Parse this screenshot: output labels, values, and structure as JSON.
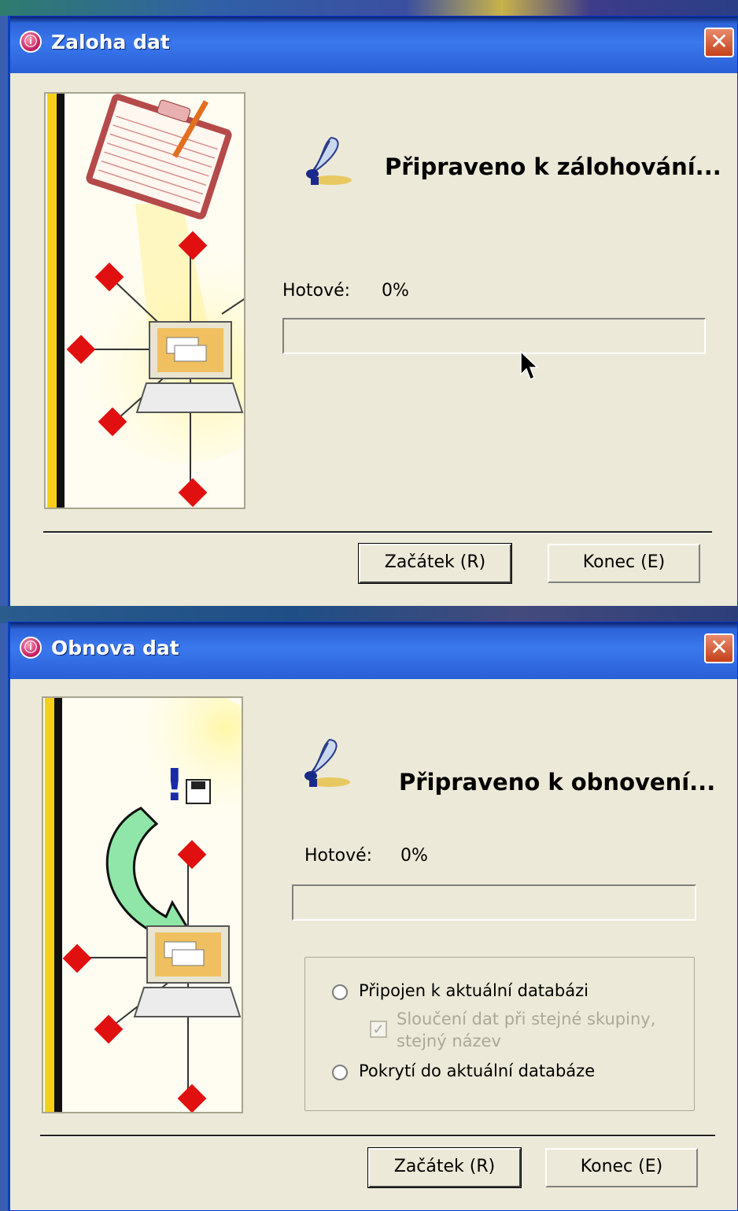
{
  "backup_dialog": {
    "title": "Zaloha dat",
    "close_glyph": "✕",
    "heading": "Připraveno k zálohování...",
    "done_label": "Hotové:",
    "done_value": "0%",
    "progress": 0,
    "start_button": "Začátek (R)",
    "end_button": "Konec (E)"
  },
  "restore_dialog": {
    "title": "Obnova dat",
    "close_glyph": "✕",
    "heading": "Připraveno k obnovení...",
    "done_label": "Hotové:",
    "done_value": "0%",
    "progress": 0,
    "options": {
      "connect_label": "Připojen k aktuální databázi",
      "merge_label_line1": "Sloučení dat při stejné skupiny,",
      "merge_label_line2": "stejný název",
      "overwrite_label": "Pokrytí do aktuální databáze"
    },
    "start_button": "Začátek (R)",
    "end_button": "Konec (E)"
  },
  "icons": {
    "app_icon": "app-icon",
    "quill": "quill-icon",
    "close": "close-icon"
  },
  "colors": {
    "titlebar": "#2d63d8",
    "dialog_bg": "#ece9d8",
    "close_button": "#c5401a",
    "accent_yellow": "#f5cf18",
    "diamond_red": "#e01010"
  }
}
